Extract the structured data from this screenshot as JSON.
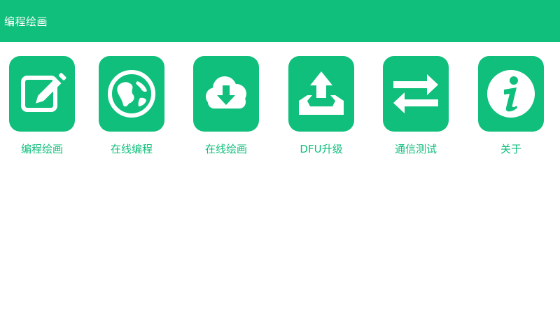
{
  "app_bar": {
    "title": "编程绘画"
  },
  "theme": {
    "accent": "#0fbf7b",
    "background": "#ffffff",
    "icon_fg": "#ffffff"
  },
  "menu": [
    {
      "label": "编程绘画",
      "icon": "edit-icon"
    },
    {
      "label": "在线编程",
      "icon": "globe-icon"
    },
    {
      "label": "在线绘画",
      "icon": "cloud-download-icon"
    },
    {
      "label": "DFU升级",
      "icon": "upload-tray-icon"
    },
    {
      "label": "通信测试",
      "icon": "swap-arrows-icon"
    },
    {
      "label": "关于",
      "icon": "info-icon"
    }
  ]
}
